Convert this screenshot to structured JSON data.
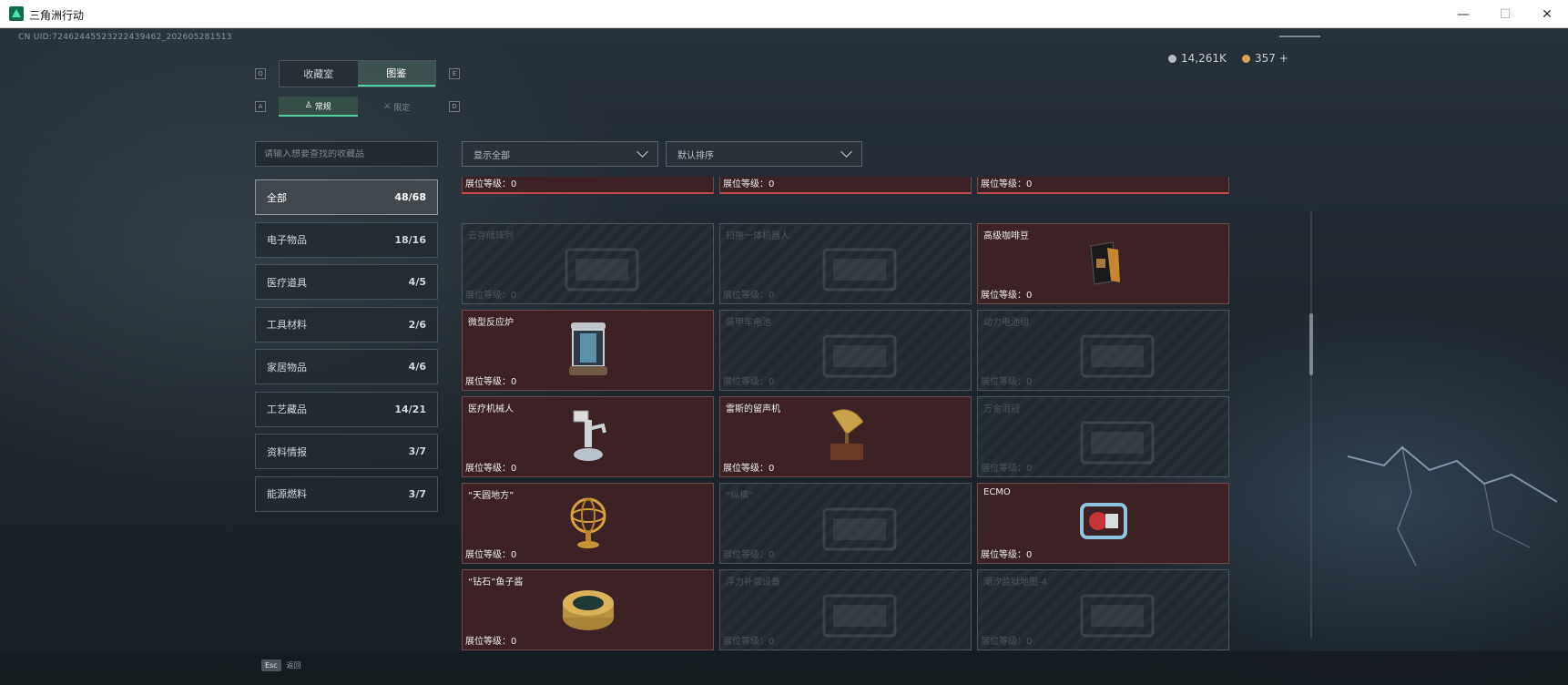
{
  "window": {
    "title": "三角洲行动",
    "minimize": "—",
    "maximize": "☐",
    "close": "✕"
  },
  "uid": "CN UID:7246244552322243946​2_202605281513",
  "currency": [
    {
      "value": "14,261K",
      "color": "#b8bcbf"
    },
    {
      "value": "357 +",
      "color": "#d9a35c"
    }
  ],
  "keys": {
    "tab_prev": "Q",
    "tab_next": "E",
    "sub_prev": "A",
    "sub_next": "D"
  },
  "main_tabs": [
    {
      "label": "收藏室",
      "active": false
    },
    {
      "label": "图鉴",
      "active": true
    }
  ],
  "sub_tabs": [
    {
      "label": "常规",
      "icon": "pawn-icon",
      "active": true
    },
    {
      "label": "限定",
      "icon": "crossed-swords-icon",
      "active": false
    }
  ],
  "search": {
    "placeholder": "请输入想要查找的收藏品"
  },
  "filters": {
    "show": "显示全部",
    "sort": "默认排序"
  },
  "categories": [
    {
      "label": "全部",
      "count": "48/68",
      "active": true
    },
    {
      "label": "电子物品",
      "count": "18/16",
      "active": false
    },
    {
      "label": "医疗道具",
      "count": "4/5",
      "active": false
    },
    {
      "label": "工具材料",
      "count": "2/6",
      "active": false
    },
    {
      "label": "家居物品",
      "count": "4/6",
      "active": false
    },
    {
      "label": "工艺藏品",
      "count": "14/21",
      "active": false
    },
    {
      "label": "资料情报",
      "count": "3/7",
      "active": false
    },
    {
      "label": "能源燃料",
      "count": "3/7",
      "active": false
    }
  ],
  "level_label": "展位等级：",
  "top_row_level": "展位等级：0",
  "items": [
    {
      "name": "云存储阵列",
      "level": "0",
      "owned": false,
      "icon": "server-array-icon"
    },
    {
      "name": "扫拖一体机器人",
      "level": "0",
      "owned": false,
      "icon": "robot-vacuum-icon"
    },
    {
      "name": "高级咖啡豆",
      "level": "0",
      "owned": true,
      "icon": "coffee-bag-icon"
    },
    {
      "name": "微型反应炉",
      "level": "0",
      "owned": true,
      "icon": "reactor-icon"
    },
    {
      "name": "装甲车电池",
      "level": "0",
      "owned": false,
      "icon": "battery-icon"
    },
    {
      "name": "动力电池组",
      "level": "0",
      "owned": false,
      "icon": "battery-pack-icon"
    },
    {
      "name": "医疗机械人",
      "level": "0",
      "owned": true,
      "icon": "medical-robot-icon"
    },
    {
      "name": "雷斯的留声机",
      "level": "0",
      "owned": true,
      "icon": "gramophone-icon"
    },
    {
      "name": "万金泪冠",
      "level": "0",
      "owned": false,
      "icon": "crown-icon"
    },
    {
      "name": "“天圆地方”",
      "level": "0",
      "owned": true,
      "icon": "armillary-sphere-icon"
    },
    {
      "name": "“纵横”",
      "level": "0",
      "owned": false,
      "icon": "board-game-icon"
    },
    {
      "name": "ECMO",
      "level": "0",
      "owned": true,
      "icon": "ecmo-machine-icon"
    },
    {
      "name": "“钻石”鱼子酱",
      "level": "0",
      "owned": true,
      "icon": "caviar-tin-icon"
    },
    {
      "name": "浮力补偿设备",
      "level": "0",
      "owned": false,
      "icon": "buoyancy-device-icon"
    },
    {
      "name": "潮汐监狱地图-4",
      "level": "0",
      "owned": false,
      "icon": "map-icon"
    }
  ],
  "bottom": {
    "esc_key": "Esc",
    "esc_label": "返回"
  }
}
